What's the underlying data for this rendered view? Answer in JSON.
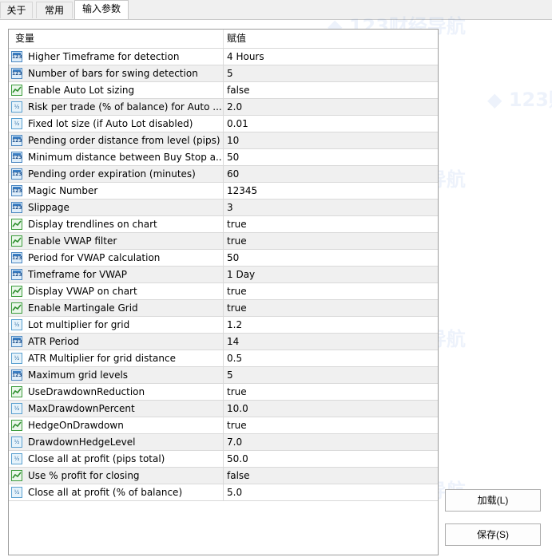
{
  "tabs": [
    {
      "label": "关于"
    },
    {
      "label": "常用"
    },
    {
      "label": "输入参数"
    }
  ],
  "table": {
    "headers": {
      "variable": "变量",
      "value": "赋值"
    },
    "rows": [
      {
        "type": "int",
        "name": "Higher Timeframe for detection",
        "value": "4 Hours"
      },
      {
        "type": "int",
        "name": "Number of bars for swing detection",
        "value": "5"
      },
      {
        "type": "bool",
        "name": "Enable Auto Lot sizing",
        "value": "false"
      },
      {
        "type": "double",
        "name": "Risk per trade (% of balance) for Auto ...",
        "value": "2.0"
      },
      {
        "type": "double",
        "name": "Fixed lot size (if Auto Lot disabled)",
        "value": "0.01"
      },
      {
        "type": "int",
        "name": "Pending order distance from level (pips)",
        "value": "10"
      },
      {
        "type": "int",
        "name": "Minimum distance between Buy Stop a...",
        "value": "50"
      },
      {
        "type": "int",
        "name": "Pending order expiration (minutes)",
        "value": "60"
      },
      {
        "type": "int",
        "name": "Magic Number",
        "value": "12345"
      },
      {
        "type": "int",
        "name": "Slippage",
        "value": "3"
      },
      {
        "type": "bool",
        "name": "Display trendlines on chart",
        "value": "true"
      },
      {
        "type": "bool",
        "name": "Enable VWAP filter",
        "value": "true"
      },
      {
        "type": "int",
        "name": "Period for VWAP calculation",
        "value": "50"
      },
      {
        "type": "int",
        "name": "Timeframe for VWAP",
        "value": "1 Day"
      },
      {
        "type": "bool",
        "name": "Display VWAP on chart",
        "value": "true"
      },
      {
        "type": "bool",
        "name": "Enable Martingale Grid",
        "value": "true"
      },
      {
        "type": "double",
        "name": "Lot multiplier for grid",
        "value": "1.2"
      },
      {
        "type": "int",
        "name": "ATR Period",
        "value": "14"
      },
      {
        "type": "double",
        "name": "ATR Multiplier for grid distance",
        "value": "0.5"
      },
      {
        "type": "int",
        "name": "Maximum grid levels",
        "value": "5"
      },
      {
        "type": "bool",
        "name": "UseDrawdownReduction",
        "value": "true"
      },
      {
        "type": "double",
        "name": "MaxDrawdownPercent",
        "value": "10.0"
      },
      {
        "type": "bool",
        "name": "HedgeOnDrawdown",
        "value": "true"
      },
      {
        "type": "double",
        "name": "DrawdownHedgeLevel",
        "value": "7.0"
      },
      {
        "type": "double",
        "name": "Close all at profit (pips total)",
        "value": "50.0"
      },
      {
        "type": "bool",
        "name": "Use % profit for closing",
        "value": "false"
      },
      {
        "type": "double",
        "name": "Close all at profit (% of balance)",
        "value": "5.0"
      }
    ]
  },
  "icons": {
    "int_text": "123",
    "double_text": "½"
  },
  "buttons": {
    "load": "加载(L)",
    "save": "保存(S)"
  },
  "watermark": "123财经导航"
}
